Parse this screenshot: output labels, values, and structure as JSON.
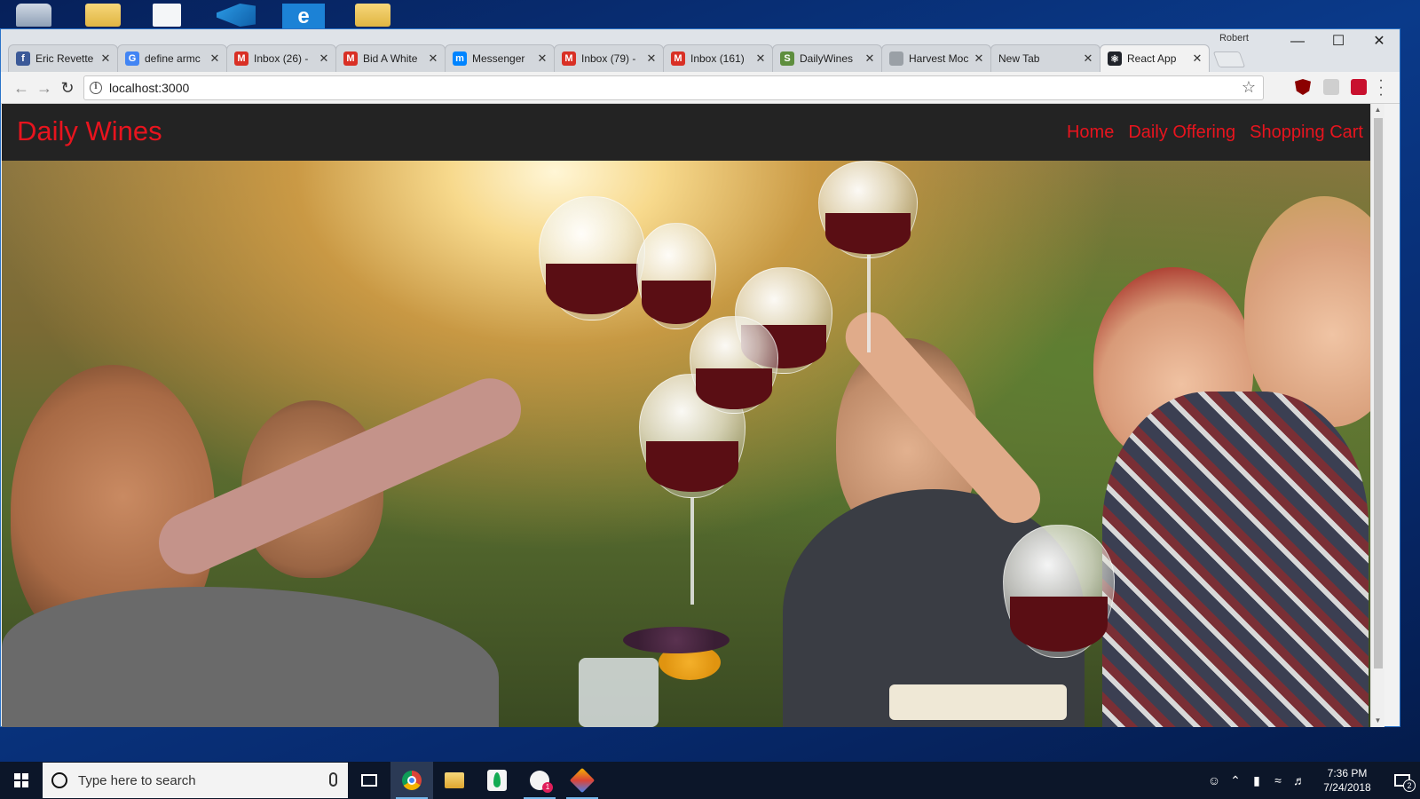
{
  "browser": {
    "profile_name": "Robert",
    "tabs": [
      {
        "title": "Eric Revette",
        "icon": "facebook-icon",
        "color": "#3b5998",
        "glyph": "f"
      },
      {
        "title": "define armc",
        "icon": "google-icon",
        "color": "#4285f4",
        "glyph": "G"
      },
      {
        "title": "Inbox (26) -",
        "icon": "gmail-icon",
        "color": "#d93025",
        "glyph": "M"
      },
      {
        "title": "Bid A White",
        "icon": "gmail-icon",
        "color": "#d93025",
        "glyph": "M"
      },
      {
        "title": "Messenger",
        "icon": "messenger-icon",
        "color": "#0084ff",
        "glyph": "m"
      },
      {
        "title": "Inbox (79) -",
        "icon": "gmail-icon",
        "color": "#d93025",
        "glyph": "M"
      },
      {
        "title": "Inbox (161)",
        "icon": "gmail-icon",
        "color": "#d93025",
        "glyph": "M"
      },
      {
        "title": "DailyWines",
        "icon": "shopify-icon",
        "color": "#5e8e3e",
        "glyph": "S"
      },
      {
        "title": "Harvest Moc",
        "icon": "document-icon",
        "color": "#9aa0a6",
        "glyph": ""
      },
      {
        "title": "New Tab",
        "icon": "",
        "color": "",
        "glyph": ""
      },
      {
        "title": "React App",
        "icon": "react-icon",
        "color": "#20232a",
        "glyph": "⚛"
      }
    ],
    "active_tab_index": 10,
    "address": "localhost:3000"
  },
  "site": {
    "brand": "Daily Wines",
    "nav": [
      "Home",
      "Daily Offering",
      "Shopping Cart"
    ],
    "accent_color": "#e8141e",
    "navbar_color": "#232323",
    "hero_image": "Friends toasting with red wine glasses outdoors at sunset in a vineyard"
  },
  "taskbar": {
    "search_placeholder": "Type here to search",
    "apps": [
      "task-view",
      "chrome",
      "file-explorer",
      "mongodb-compass",
      "slack",
      "gitkraken"
    ],
    "slack_badge": "1",
    "time": "7:36 PM",
    "date": "7/24/2018",
    "notification_count": "2"
  }
}
